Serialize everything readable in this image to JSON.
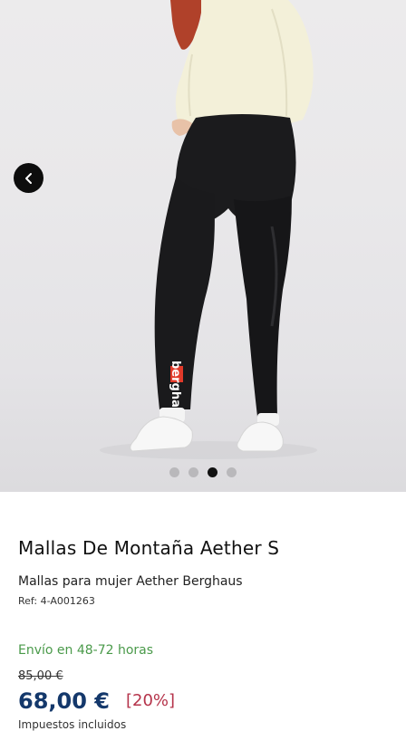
{
  "gallery": {
    "prev_icon": "chevron-left-icon",
    "slide_count": 4,
    "active_slide": 3,
    "logo_text": "berghaus",
    "colors": {
      "background": "#e9e8ea",
      "button": "#0d0d0d",
      "dot_inactive": "#b9b8bb",
      "dot_active": "#111111"
    }
  },
  "product": {
    "title": "Mallas De Montaña Aether S",
    "subtitle": "Mallas para mujer Aether Berghaus",
    "ref": "Ref: 4-A001263",
    "shipping": "Envío en 48-72 horas",
    "old_price": "85,00 €",
    "price": "68,00 €",
    "discount": "[20%]",
    "taxes": "Impuestos incluidos"
  },
  "colors": {
    "shipping": "#4a9a4a",
    "price": "#14386b",
    "discount": "#b5334a"
  }
}
